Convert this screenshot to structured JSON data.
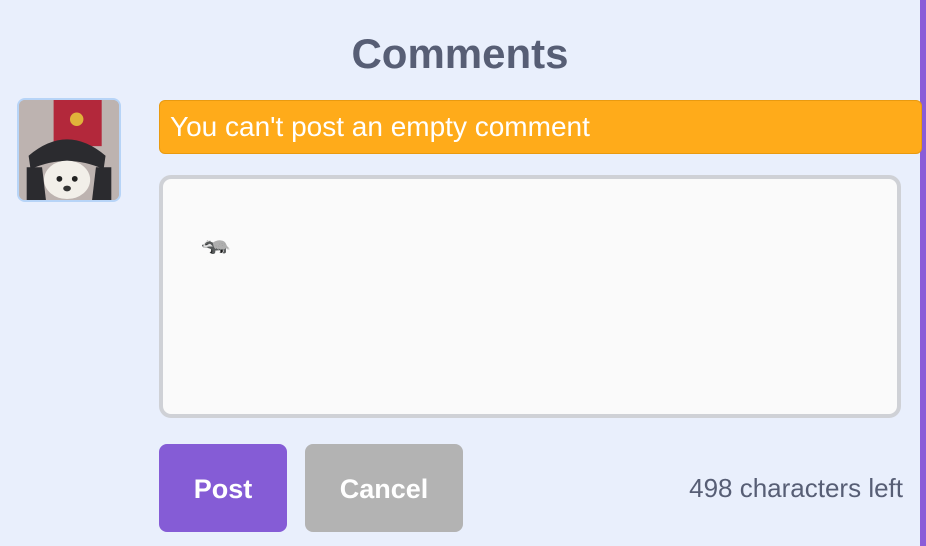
{
  "comments": {
    "title": "Comments",
    "error_message": "You can't post an empty comment",
    "textarea": {
      "value": "🦡"
    },
    "buttons": {
      "post_label": "Post",
      "cancel_label": "Cancel"
    },
    "chars_left": "498 characters left"
  },
  "colors": {
    "background": "#e9effc",
    "title": "#575e75",
    "error_banner": "#ffab1a",
    "post_button": "#855cd6",
    "cancel_button": "#b3b3b3",
    "textarea_border": "#cfd1d6",
    "right_edge": "#8a5cd8"
  },
  "icons": {
    "avatar": "user-avatar-photo"
  }
}
